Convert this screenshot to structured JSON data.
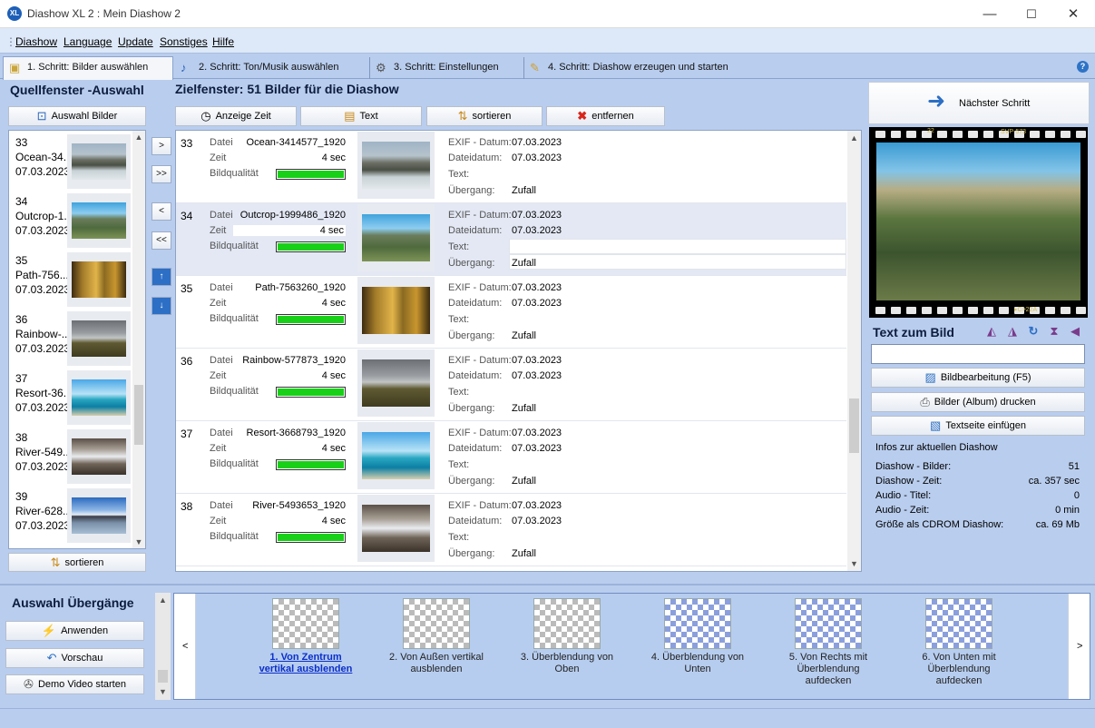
{
  "window": {
    "title": "Diashow XL 2 : Mein Diashow 2",
    "logo": "XL",
    "minimize": "—",
    "maximize": "☐",
    "close": "✕"
  },
  "menu": [
    "Diashow",
    "Language",
    "Update",
    "Sonstiges",
    "Hilfe"
  ],
  "tabs": [
    {
      "label": "1. Schritt: Bilder auswählen",
      "icon": "image-icon"
    },
    {
      "label": "2. Schritt: Ton/Musik auswählen",
      "icon": "music-icon"
    },
    {
      "label": "3. Schritt: Einstellungen",
      "icon": "gear-icon"
    },
    {
      "label": "4. Schritt: Diashow erzeugen und starten",
      "icon": "pen-icon"
    }
  ],
  "help": "?",
  "source": {
    "title": "Quellfenster -Auswahl",
    "select_button": "Auswahl Bilder",
    "sort_button": "sortieren",
    "items": [
      {
        "num": "33",
        "name": "Ocean-34...",
        "date": "07.03.2023",
        "thumb": "ocean"
      },
      {
        "num": "34",
        "name": "Outcrop-1...",
        "date": "07.03.2023",
        "thumb": "outcrop"
      },
      {
        "num": "35",
        "name": "Path-756...",
        "date": "07.03.2023",
        "thumb": "path"
      },
      {
        "num": "36",
        "name": "Rainbow-...",
        "date": "07.03.2023",
        "thumb": "rainbow"
      },
      {
        "num": "37",
        "name": "Resort-36...",
        "date": "07.03.2023",
        "thumb": "resort"
      },
      {
        "num": "38",
        "name": "River-549...",
        "date": "07.03.2023",
        "thumb": "river"
      },
      {
        "num": "39",
        "name": "River-628...",
        "date": "07.03.2023",
        "thumb": "river2"
      }
    ]
  },
  "move_buttons": [
    ">",
    ">>",
    "<",
    "<<",
    "↑",
    "↓"
  ],
  "target": {
    "title": "Zielfenster: 51 Bilder für die Diashow",
    "toolbar": {
      "time": "Anzeige Zeit",
      "text": "Text",
      "sort": "sortieren",
      "remove": "entfernen"
    },
    "labels": {
      "file": "Datei",
      "time": "Zeit",
      "quality": "Bildqualität",
      "exif": "EXIF - Datum:",
      "filedate": "Dateidatum:",
      "text": "Text:",
      "transition": "Übergang:"
    },
    "rows": [
      {
        "num": "33",
        "file": "Ocean-3414577_1920",
        "time": "4 sec",
        "quality": 1.0,
        "exif": "07.03.2023",
        "filedate": "07.03.2023",
        "text": "",
        "transition": "Zufall",
        "thumb": "ocean",
        "selected": false
      },
      {
        "num": "34",
        "file": "Outcrop-1999486_1920",
        "time": "4 sec",
        "quality": 1.0,
        "exif": "07.03.2023",
        "filedate": "07.03.2023",
        "text": "",
        "transition": "Zufall",
        "thumb": "outcrop",
        "selected": true
      },
      {
        "num": "35",
        "file": "Path-7563260_1920",
        "time": "4 sec",
        "quality": 1.0,
        "exif": "07.03.2023",
        "filedate": "07.03.2023",
        "text": "",
        "transition": "Zufall",
        "thumb": "path",
        "selected": false
      },
      {
        "num": "36",
        "file": "Rainbow-577873_1920",
        "time": "4 sec",
        "quality": 1.0,
        "exif": "07.03.2023",
        "filedate": "07.03.2023",
        "text": "",
        "transition": "Zufall",
        "thumb": "rainbow",
        "selected": false
      },
      {
        "num": "37",
        "file": "Resort-3668793_1920",
        "time": "4 sec",
        "quality": 1.0,
        "exif": "07.03.2023",
        "filedate": "07.03.2023",
        "text": "",
        "transition": "Zufall",
        "thumb": "resort",
        "selected": false
      },
      {
        "num": "38",
        "file": "River-5493653_1920",
        "time": "4 sec",
        "quality": 1.0,
        "exif": "07.03.2023",
        "filedate": "07.03.2023",
        "text": "",
        "transition": "Zufall",
        "thumb": "river",
        "selected": false
      }
    ]
  },
  "right": {
    "next_step": "Nächster Schritt",
    "preview_marks": {
      "frame_num": "22",
      "code": "SVP-573",
      "edge": "▸C>22A"
    },
    "text_title": "Text zum Bild",
    "text_value": "",
    "buttons": {
      "edit": "Bildbearbeitung (F5)",
      "print": "Bilder (Album) drucken",
      "textpage": "Textseite einfügen"
    },
    "info_title": "Infos zur aktuellen Diashow",
    "info": [
      {
        "label": "Diashow - Bilder:",
        "value": "51"
      },
      {
        "label": "Diashow - Zeit:",
        "value": "ca. 357 sec"
      },
      {
        "label": "Audio - Titel:",
        "value": "0"
      },
      {
        "label": "Audio - Zeit:",
        "value": "0 min"
      },
      {
        "label": "Größe als CDROM Diashow:",
        "value": "ca. 69 Mb"
      }
    ]
  },
  "transitions": {
    "title": "Auswahl Übergänge",
    "apply": "Anwenden",
    "preview": "Vorschau",
    "demo": "Demo Video starten",
    "prev": "<",
    "next": ">",
    "items": [
      {
        "label": "1. Von Zentrum vertikal ausblenden",
        "active": true,
        "blue": false
      },
      {
        "label": "2. Von Außen vertikal ausblenden",
        "active": false,
        "blue": false
      },
      {
        "label": "3. Überblendung von Oben",
        "active": false,
        "blue": false
      },
      {
        "label": "4. Überblendung von Unten",
        "active": false,
        "blue": true
      },
      {
        "label": "5. Von Rechts mit Überblendung aufdecken",
        "active": false,
        "blue": true
      },
      {
        "label": "6. Von Unten mit Überblendung aufdecken",
        "active": false,
        "blue": true
      }
    ]
  },
  "colors": {
    "accent": "#1d5fb8",
    "quality_bar": "#18d018",
    "active_transition": "#0b2fc9"
  }
}
